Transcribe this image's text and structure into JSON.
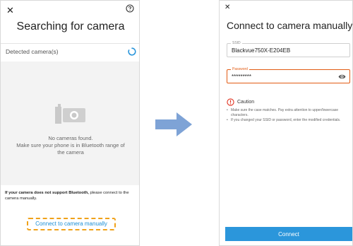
{
  "left_screen": {
    "close_glyph": "✕",
    "title": "Searching for camera",
    "detected_label": "Detected camera(s)",
    "empty_title": "No cameras found.",
    "empty_subtitle": "Make sure your phone is in Bluetooth range of the camera",
    "bluetooth_note_bold": "If your camera does not support Bluetooth,",
    "bluetooth_note_rest": " please connect to the camera manually.",
    "manual_link": "Connect to camera manually",
    "icons": [
      "close-icon",
      "help-icon",
      "spinner-icon",
      "camera-icon"
    ]
  },
  "right_screen": {
    "close_glyph": "✕",
    "title": "Connect to camera manually",
    "ssid_label": "SSID",
    "ssid_value": "Blackvue750X-E204EB",
    "password_label": "Password",
    "password_value": "*********",
    "caution_title": "Caution",
    "caution_items": [
      "Make sure the case matches. Pay extra attention to upper/lowercase characters.",
      "If you changed your SSID or password, enter the modified credentials."
    ],
    "connect_button": "Connect",
    "icons": [
      "close-icon",
      "eye-icon",
      "caution-icon"
    ]
  },
  "colors": {
    "accent_blue": "#2b96db",
    "link_blue": "#1d8fd6",
    "highlight_orange": "#f0a21a",
    "error_red": "#e25b14",
    "arrow_blue": "#7ea3d6"
  }
}
